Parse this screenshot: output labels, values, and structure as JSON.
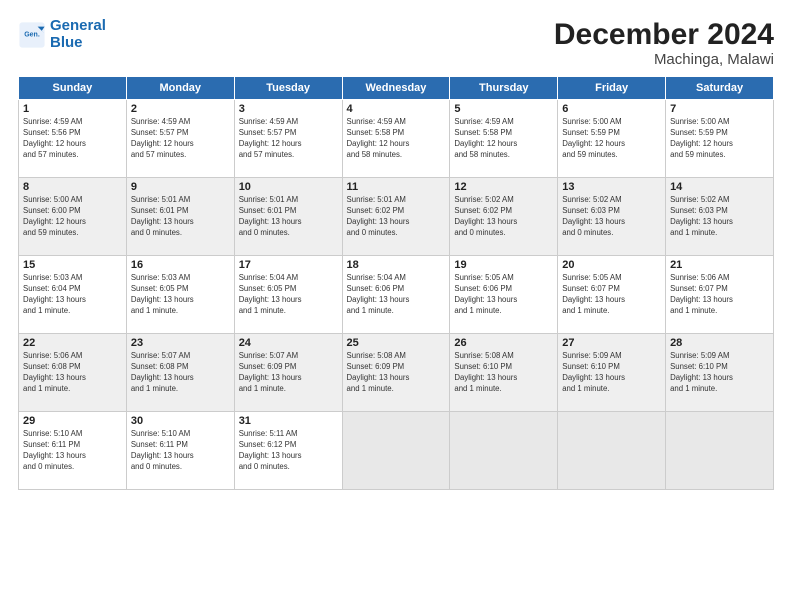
{
  "logo": {
    "line1": "General",
    "line2": "Blue"
  },
  "title": "December 2024",
  "location": "Machinga, Malawi",
  "headers": [
    "Sunday",
    "Monday",
    "Tuesday",
    "Wednesday",
    "Thursday",
    "Friday",
    "Saturday"
  ],
  "rows": [
    [
      {
        "day": "1",
        "info": "Sunrise: 4:59 AM\nSunset: 5:56 PM\nDaylight: 12 hours\nand 57 minutes."
      },
      {
        "day": "2",
        "info": "Sunrise: 4:59 AM\nSunset: 5:57 PM\nDaylight: 12 hours\nand 57 minutes."
      },
      {
        "day": "3",
        "info": "Sunrise: 4:59 AM\nSunset: 5:57 PM\nDaylight: 12 hours\nand 57 minutes."
      },
      {
        "day": "4",
        "info": "Sunrise: 4:59 AM\nSunset: 5:58 PM\nDaylight: 12 hours\nand 58 minutes."
      },
      {
        "day": "5",
        "info": "Sunrise: 4:59 AM\nSunset: 5:58 PM\nDaylight: 12 hours\nand 58 minutes."
      },
      {
        "day": "6",
        "info": "Sunrise: 5:00 AM\nSunset: 5:59 PM\nDaylight: 12 hours\nand 59 minutes."
      },
      {
        "day": "7",
        "info": "Sunrise: 5:00 AM\nSunset: 5:59 PM\nDaylight: 12 hours\nand 59 minutes."
      }
    ],
    [
      {
        "day": "8",
        "info": "Sunrise: 5:00 AM\nSunset: 6:00 PM\nDaylight: 12 hours\nand 59 minutes."
      },
      {
        "day": "9",
        "info": "Sunrise: 5:01 AM\nSunset: 6:01 PM\nDaylight: 13 hours\nand 0 minutes."
      },
      {
        "day": "10",
        "info": "Sunrise: 5:01 AM\nSunset: 6:01 PM\nDaylight: 13 hours\nand 0 minutes."
      },
      {
        "day": "11",
        "info": "Sunrise: 5:01 AM\nSunset: 6:02 PM\nDaylight: 13 hours\nand 0 minutes."
      },
      {
        "day": "12",
        "info": "Sunrise: 5:02 AM\nSunset: 6:02 PM\nDaylight: 13 hours\nand 0 minutes."
      },
      {
        "day": "13",
        "info": "Sunrise: 5:02 AM\nSunset: 6:03 PM\nDaylight: 13 hours\nand 0 minutes."
      },
      {
        "day": "14",
        "info": "Sunrise: 5:02 AM\nSunset: 6:03 PM\nDaylight: 13 hours\nand 1 minute."
      }
    ],
    [
      {
        "day": "15",
        "info": "Sunrise: 5:03 AM\nSunset: 6:04 PM\nDaylight: 13 hours\nand 1 minute."
      },
      {
        "day": "16",
        "info": "Sunrise: 5:03 AM\nSunset: 6:05 PM\nDaylight: 13 hours\nand 1 minute."
      },
      {
        "day": "17",
        "info": "Sunrise: 5:04 AM\nSunset: 6:05 PM\nDaylight: 13 hours\nand 1 minute."
      },
      {
        "day": "18",
        "info": "Sunrise: 5:04 AM\nSunset: 6:06 PM\nDaylight: 13 hours\nand 1 minute."
      },
      {
        "day": "19",
        "info": "Sunrise: 5:05 AM\nSunset: 6:06 PM\nDaylight: 13 hours\nand 1 minute."
      },
      {
        "day": "20",
        "info": "Sunrise: 5:05 AM\nSunset: 6:07 PM\nDaylight: 13 hours\nand 1 minute."
      },
      {
        "day": "21",
        "info": "Sunrise: 5:06 AM\nSunset: 6:07 PM\nDaylight: 13 hours\nand 1 minute."
      }
    ],
    [
      {
        "day": "22",
        "info": "Sunrise: 5:06 AM\nSunset: 6:08 PM\nDaylight: 13 hours\nand 1 minute."
      },
      {
        "day": "23",
        "info": "Sunrise: 5:07 AM\nSunset: 6:08 PM\nDaylight: 13 hours\nand 1 minute."
      },
      {
        "day": "24",
        "info": "Sunrise: 5:07 AM\nSunset: 6:09 PM\nDaylight: 13 hours\nand 1 minute."
      },
      {
        "day": "25",
        "info": "Sunrise: 5:08 AM\nSunset: 6:09 PM\nDaylight: 13 hours\nand 1 minute."
      },
      {
        "day": "26",
        "info": "Sunrise: 5:08 AM\nSunset: 6:10 PM\nDaylight: 13 hours\nand 1 minute."
      },
      {
        "day": "27",
        "info": "Sunrise: 5:09 AM\nSunset: 6:10 PM\nDaylight: 13 hours\nand 1 minute."
      },
      {
        "day": "28",
        "info": "Sunrise: 5:09 AM\nSunset: 6:10 PM\nDaylight: 13 hours\nand 1 minute."
      }
    ],
    [
      {
        "day": "29",
        "info": "Sunrise: 5:10 AM\nSunset: 6:11 PM\nDaylight: 13 hours\nand 0 minutes."
      },
      {
        "day": "30",
        "info": "Sunrise: 5:10 AM\nSunset: 6:11 PM\nDaylight: 13 hours\nand 0 minutes."
      },
      {
        "day": "31",
        "info": "Sunrise: 5:11 AM\nSunset: 6:12 PM\nDaylight: 13 hours\nand 0 minutes."
      },
      {
        "day": "",
        "info": ""
      },
      {
        "day": "",
        "info": ""
      },
      {
        "day": "",
        "info": ""
      },
      {
        "day": "",
        "info": ""
      }
    ]
  ]
}
